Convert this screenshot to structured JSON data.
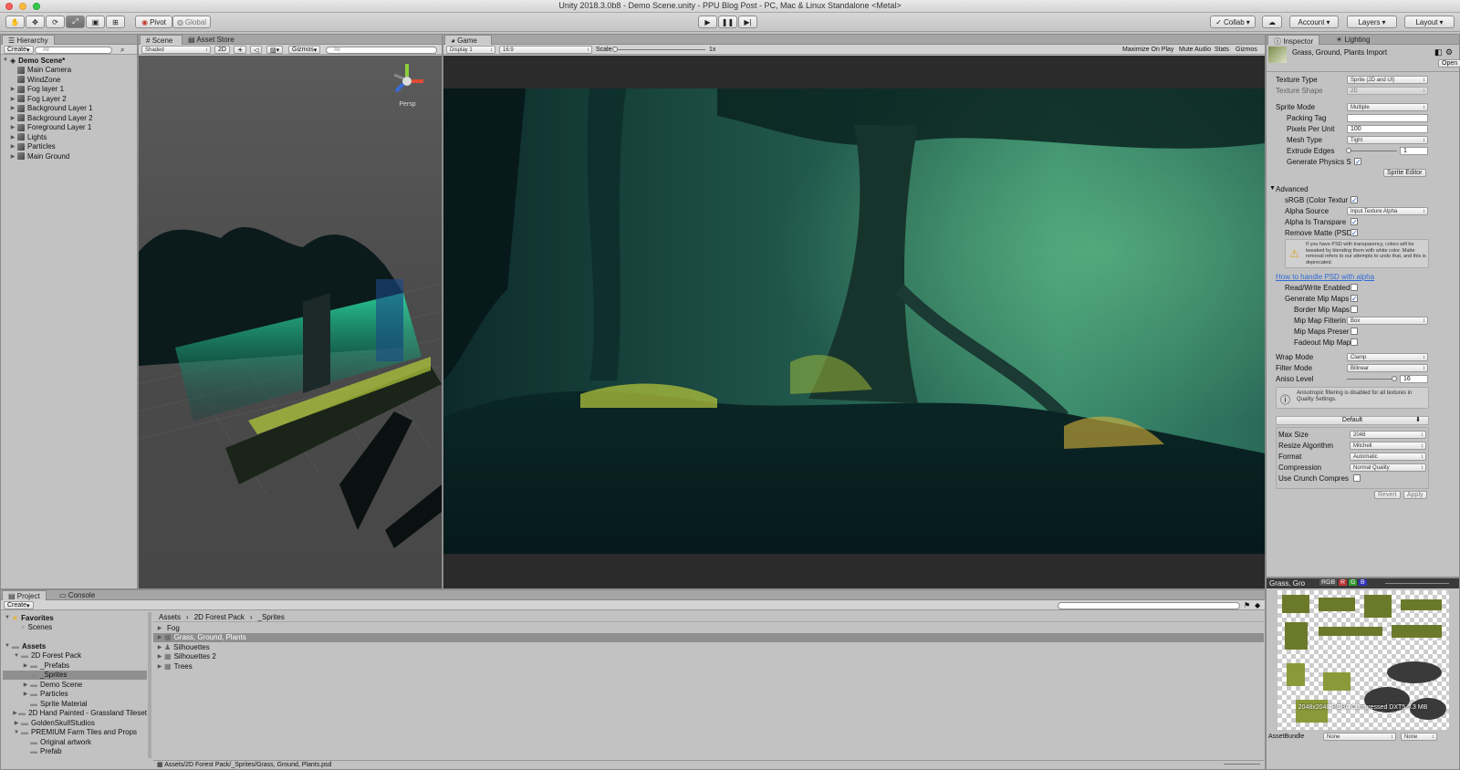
{
  "window": {
    "title": "Unity 2018.3.0b8 - Demo Scene.unity - PPU Blog Post - PC, Mac & Linux Standalone <Metal>"
  },
  "toolbar": {
    "pivot": "Pivot",
    "global": "Global",
    "collab": "Collab",
    "account": "Account",
    "layers": "Layers",
    "layout": "Layout",
    "tools": [
      "hand-tool-icon",
      "move-tool-icon",
      "rotate-tool-icon",
      "scale-tool-icon",
      "rect-tool-icon",
      "transform-tool-icon"
    ]
  },
  "hierarchy": {
    "tab": "Hierarchy",
    "create": "Create",
    "search_placeholder": "All",
    "scene": "Demo Scene*",
    "items": [
      "Main Camera",
      "WindZone",
      "Fog layer 1",
      "Fog Layer 2",
      "Background Layer 1",
      "Background Layer 2",
      "Foreground Layer 1",
      "Lights",
      "Particles",
      "Main Ground"
    ]
  },
  "scene_view": {
    "tabs": [
      "Scene",
      "Asset Store"
    ],
    "shading": "Shaded",
    "mode_2d": "2D",
    "gizmos": "Gizmos",
    "search_placeholder": "All",
    "persp": "Persp"
  },
  "game_view": {
    "tab": "Game",
    "display": "Display 1",
    "aspect": "16:9",
    "scale_label": "Scale",
    "scale_value": "1x",
    "buttons": [
      "Maximize On Play",
      "Mute Audio",
      "Stats",
      "Gizmos"
    ]
  },
  "inspector": {
    "tabs": [
      "Inspector",
      "Lighting"
    ],
    "asset_title": "Grass, Ground, Plants Import",
    "open": "Open",
    "texture_type": {
      "label": "Texture Type",
      "value": "Sprite (2D and UI)"
    },
    "texture_shape": {
      "label": "Texture Shape",
      "value": "2D"
    },
    "sprite_mode": {
      "label": "Sprite Mode",
      "value": "Multiple"
    },
    "packing_tag": {
      "label": "Packing Tag",
      "value": ""
    },
    "ppu": {
      "label": "Pixels Per Unit",
      "value": "100"
    },
    "mesh_type": {
      "label": "Mesh Type",
      "value": "Tight"
    },
    "extrude": {
      "label": "Extrude Edges",
      "value": "1"
    },
    "physics": {
      "label": "Generate Physics S"
    },
    "sprite_editor": "Sprite Editor",
    "advanced": "Advanced",
    "srgb": {
      "label": "sRGB (Color Textur"
    },
    "alpha_source": {
      "label": "Alpha Source",
      "value": "Input Texture Alpha"
    },
    "alpha_transp": {
      "label": "Alpha Is Transpare"
    },
    "remove_matte": {
      "label": "Remove Matte (PSD"
    },
    "warning": "If you have PSD with transparency, colors will be tweaked by blending them with white color. Matte removal refers to our attempts to undo that, and this is deprecated.",
    "link": "How to handle PSD with alpha",
    "read_write": {
      "label": "Read/Write Enabled"
    },
    "mipmaps": {
      "label": "Generate Mip Maps"
    },
    "border_mip": {
      "label": "Border Mip Maps"
    },
    "mip_preserve": {
      "label": "Mip Maps Preser"
    },
    "mip_filter": {
      "label": "Mip Map Filterin",
      "value": "Box"
    },
    "fadeout": {
      "label": "Fadeout Mip Map"
    },
    "wrap": {
      "label": "Wrap Mode",
      "value": "Clamp"
    },
    "filter": {
      "label": "Filter Mode",
      "value": "Bilinear"
    },
    "aniso": {
      "label": "Aniso Level",
      "value": "16",
      "fraction": 0.94
    },
    "aniso_info": "Anisotropic filtering is disabled for all textures in Quality Settings.",
    "platform": "Default",
    "max_size": {
      "label": "Max Size",
      "value": "2048"
    },
    "resize": {
      "label": "Resize Algorithm",
      "value": "Mitchell"
    },
    "format": {
      "label": "Format",
      "value": "Automatic"
    },
    "compression": {
      "label": "Compression",
      "value": "Normal Quality"
    },
    "crunch": {
      "label": "Use Crunch Compres"
    },
    "revert": "Revert",
    "apply": "Apply"
  },
  "preview": {
    "title": "Grass, Gro",
    "channels": [
      "RGB",
      "R",
      "G",
      "B"
    ],
    "info": "2048x2048 RGBA Compressed DXT5 5.3 MB",
    "assetbundle": "AssetBundle",
    "none1": "None",
    "none2": "None"
  },
  "project": {
    "tabs": [
      "Project",
      "Console"
    ],
    "create": "Create",
    "favorites": "Favorites",
    "scenes": "Scenes",
    "assets": "Assets",
    "tree": [
      "2D Forest Pack",
      "_Prefabs",
      "_Sprites",
      "Demo Scene",
      "Particles",
      "Sprite Material",
      "2D Hand Painted - Grassland Tileset",
      "GoldenSkullStudios",
      "PREMIUM Farm Tiles and Props",
      "Original artwork",
      "Prefab"
    ],
    "breadcrumb": [
      "Assets",
      "2D Forest Pack",
      "_Sprites"
    ],
    "files": [
      "Fog",
      "Grass, Ground, Plants",
      "Silhouettes",
      "Silhouettes 2",
      "Trees"
    ],
    "path": "Assets/2D Forest Pack/_Sprites/Grass, Ground, Plants.psd"
  }
}
